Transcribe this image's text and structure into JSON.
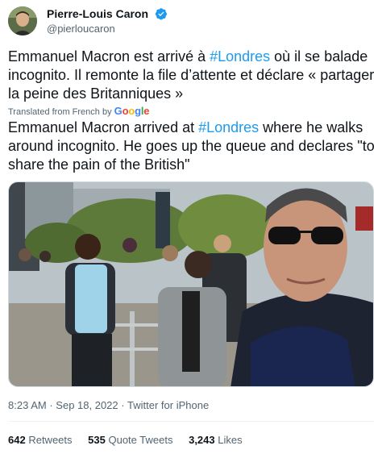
{
  "author": {
    "name": "Pierre-Louis Caron",
    "handle": "@pierloucaron"
  },
  "tweet": {
    "text_before": "Emmanuel Macron est arrivé à ",
    "hashtag": "#Londres",
    "text_after": " où il se balade incognito. Il remonte la file d’attente et déclare « partager la peine des Britanniques »"
  },
  "translation": {
    "label": "Translated from French by",
    "provider_letters": [
      "G",
      "o",
      "o",
      "g",
      "l",
      "e"
    ],
    "text_before": "Emmanuel Macron arrived at ",
    "hashtag": "#Londres",
    "text_after": " where he walks around incognito. He goes up the queue and declares \"to share the pain of the British\""
  },
  "meta": {
    "time": "8:23 AM",
    "date": "Sep 18, 2022",
    "source": "Twitter for iPhone",
    "separator": "·"
  },
  "stats": {
    "retweets_count": "642",
    "retweets_label": "Retweets",
    "quotes_count": "535",
    "quotes_label": "Quote Tweets",
    "likes_count": "3,243",
    "likes_label": "Likes"
  },
  "colors": {
    "link": "#1d9bf0",
    "verified": "#1d9bf0",
    "secondary_text": "#536471"
  }
}
